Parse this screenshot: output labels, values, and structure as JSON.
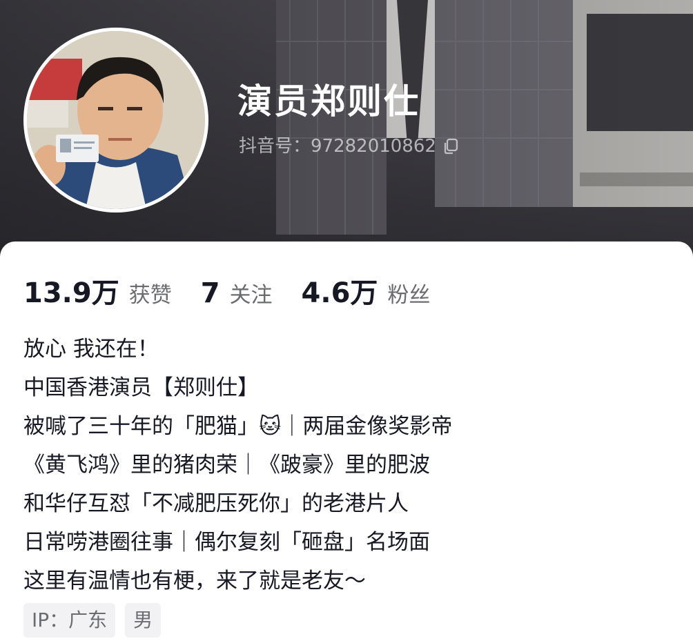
{
  "profile": {
    "name": "演员郑则仕",
    "id_label": "抖音号：",
    "id_value": "97282010862",
    "avatar_icon": "person-avatar-icon",
    "copy_icon": "copy-icon"
  },
  "stats": [
    {
      "value": "13.9万",
      "label": "获赞"
    },
    {
      "value": "7",
      "label": "关注"
    },
    {
      "value": "4.6万",
      "label": "粉丝"
    }
  ],
  "bio": [
    "放心 我还在！",
    "中国香港演员【郑则仕】",
    "被喊了三十年的「肥猫」🐱｜两届金像奖影帝",
    "《黄飞鸿》里的猪肉荣｜《跛豪》里的肥波",
    "和华仔互怼「不减肥压死你」的老港片人",
    "日常唠港圈往事｜偶尔复刻「砸盘」名场面",
    "这里有温情也有梗，来了就是老友～"
  ],
  "tags": {
    "ip": "IP：广东",
    "gender": "男"
  },
  "colors": {
    "text_primary": "#161823",
    "text_secondary": "#6b6c70",
    "tag_bg": "#f2f2f4"
  }
}
